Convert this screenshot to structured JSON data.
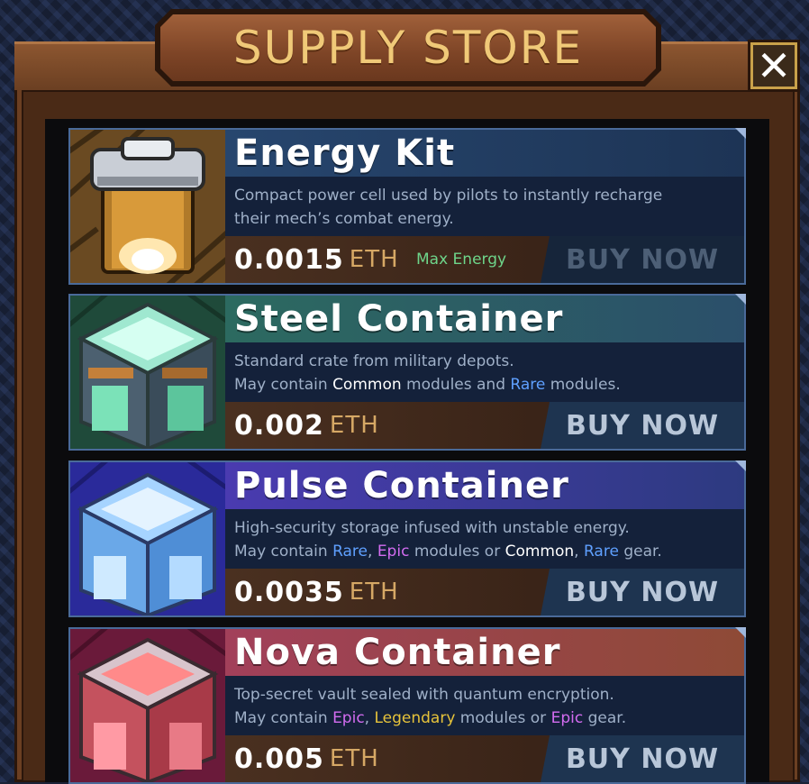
{
  "window": {
    "title": "SUPPLY STORE",
    "close_glyph": "✕"
  },
  "colors": {
    "accent_gold": "#f0c978",
    "eth": "#d6a865",
    "common": "#ffffff",
    "rare": "#5fa0ff",
    "epic": "#d36cf0",
    "legendary": "#e6c33a",
    "energy_tag": "#6ed58a"
  },
  "items": [
    {
      "name": "Energy Kit",
      "icon": "energy-canister-icon",
      "desc_line1": "Compact power cell used by pilots to instantly recharge",
      "desc_line2": "their mech’s combat energy.",
      "price": "0.0015",
      "currency": "ETH",
      "tag": "Max Energy",
      "buy_label": "BUY NOW"
    },
    {
      "name": "Steel Container",
      "icon": "steel-crate-icon",
      "desc_line1": "Standard crate from military depots.",
      "desc_parts": [
        "May contain ",
        "Common",
        " modules and ",
        "Rare",
        " modules."
      ],
      "price": "0.002",
      "currency": "ETH",
      "buy_label": "BUY NOW"
    },
    {
      "name": "Pulse Container",
      "icon": "pulse-crate-icon",
      "desc_line1": "High-security storage infused with unstable energy.",
      "desc_parts": [
        "May contain ",
        "Rare",
        ", ",
        "Epic",
        " modules or ",
        "Common",
        ", ",
        "Rare",
        " gear."
      ],
      "price": "0.0035",
      "currency": "ETH",
      "buy_label": "BUY NOW"
    },
    {
      "name": "Nova Container",
      "icon": "nova-crate-icon",
      "desc_line1": "Top-secret vault sealed with quantum encryption.",
      "desc_parts": [
        "May contain ",
        "Epic",
        ", ",
        "Legendary",
        " modules or ",
        "Epic",
        " gear."
      ],
      "price": "0.005",
      "currency": "ETH",
      "buy_label": "BUY NOW"
    }
  ]
}
